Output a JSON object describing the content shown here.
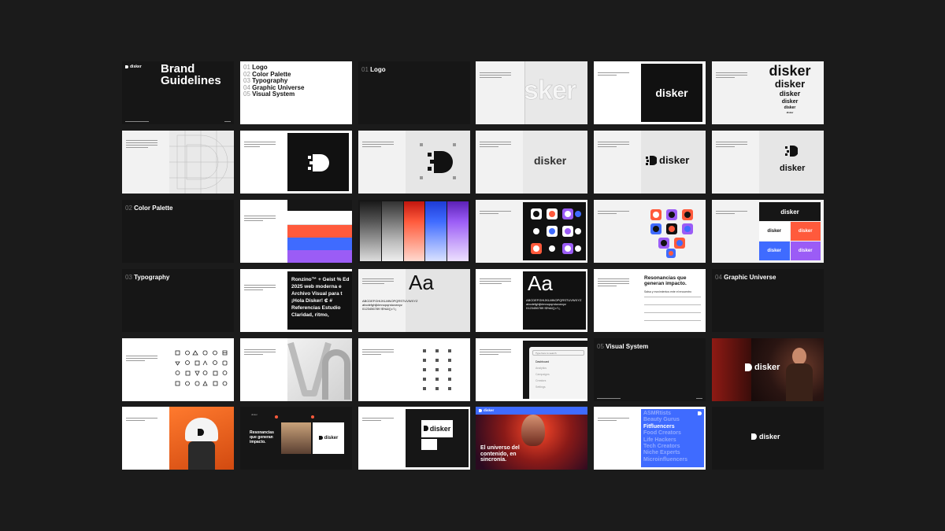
{
  "brand": "disker",
  "cover": {
    "title_line1": "Brand",
    "title_line2": "Guidelines"
  },
  "toc": [
    {
      "num": "01",
      "label": "Logo"
    },
    {
      "num": "02",
      "label": "Color Palette"
    },
    {
      "num": "03",
      "label": "Typography"
    },
    {
      "num": "04",
      "label": "Graphic Universe"
    },
    {
      "num": "05",
      "label": "Visual System"
    }
  ],
  "sections": {
    "logo": {
      "num": "01",
      "label": "Logo"
    },
    "color": {
      "num": "02",
      "label": "Color Palette"
    },
    "type": {
      "num": "03",
      "label": "Typography"
    },
    "graphic": {
      "num": "04",
      "label": "Graphic Universe"
    },
    "visual": {
      "num": "05",
      "label": "Visual System"
    }
  },
  "logo_stack": [
    "disker",
    "disker",
    "disker",
    "disker",
    "disker",
    "disker"
  ],
  "wordmark_fragment": "sker",
  "type_specimen": {
    "lines": [
      "Ronzino™ + Geist % Ed",
      "2025 web moderna e",
      "Archivo Visual para t",
      "¡Hola Disker! ₡ # ",
      "Referencias Estudio ",
      "Claridad, ritmo, "
    ],
    "aa": "Aa",
    "alphabet_upper": "ABCDEFGHIJKLMNOPQRSTUVWXYZ",
    "alphabet_lower": "abcdefghijklmnopqrstuvwxyz",
    "digits": "0123456789 !$%&/()=?¿"
  },
  "resonancias": {
    "title": "Resonancias que generan impacto.",
    "subtitle": "Salsa y movimientos ente el encuentro"
  },
  "dashboard": {
    "search": "Type here to search",
    "items": [
      "Dashboard",
      "Analytics",
      "Campaigns",
      "Creators",
      "Settings"
    ]
  },
  "mockup_headline": "Resonancias que generan impacto.",
  "poster_headline": "El universo del contenido, en sincronía.",
  "creators": [
    "ASMRtists",
    "Beauty Gurus",
    "Fitfluencers",
    "Food Creators",
    "Life Hackers",
    "Tech Creators",
    "Niche Experts",
    "Microinfluencers"
  ],
  "colors": {
    "bg": "#1b1b1b",
    "dark": "#161616",
    "orange": "#ff5a3c",
    "blue": "#3f6bff",
    "purple": "#9b5cf6",
    "light": "#f2f2f2"
  }
}
